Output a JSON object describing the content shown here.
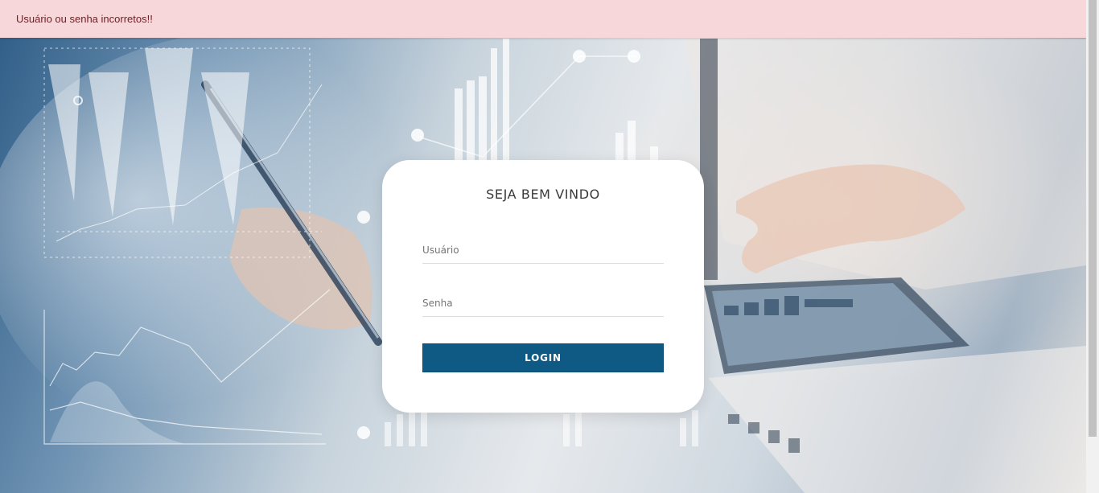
{
  "alert": {
    "message": "Usuário ou senha incorretos!!",
    "background_color": "#f8d7da",
    "text_color": "#721c24"
  },
  "login_card": {
    "title": "SEJA BEM VINDO",
    "username_placeholder": "Usuário",
    "password_placeholder": "Senha",
    "login_button_label": "LOGIN",
    "button_color": "#0e5a85"
  },
  "icons": {
    "background": "business-analytics-photo"
  }
}
